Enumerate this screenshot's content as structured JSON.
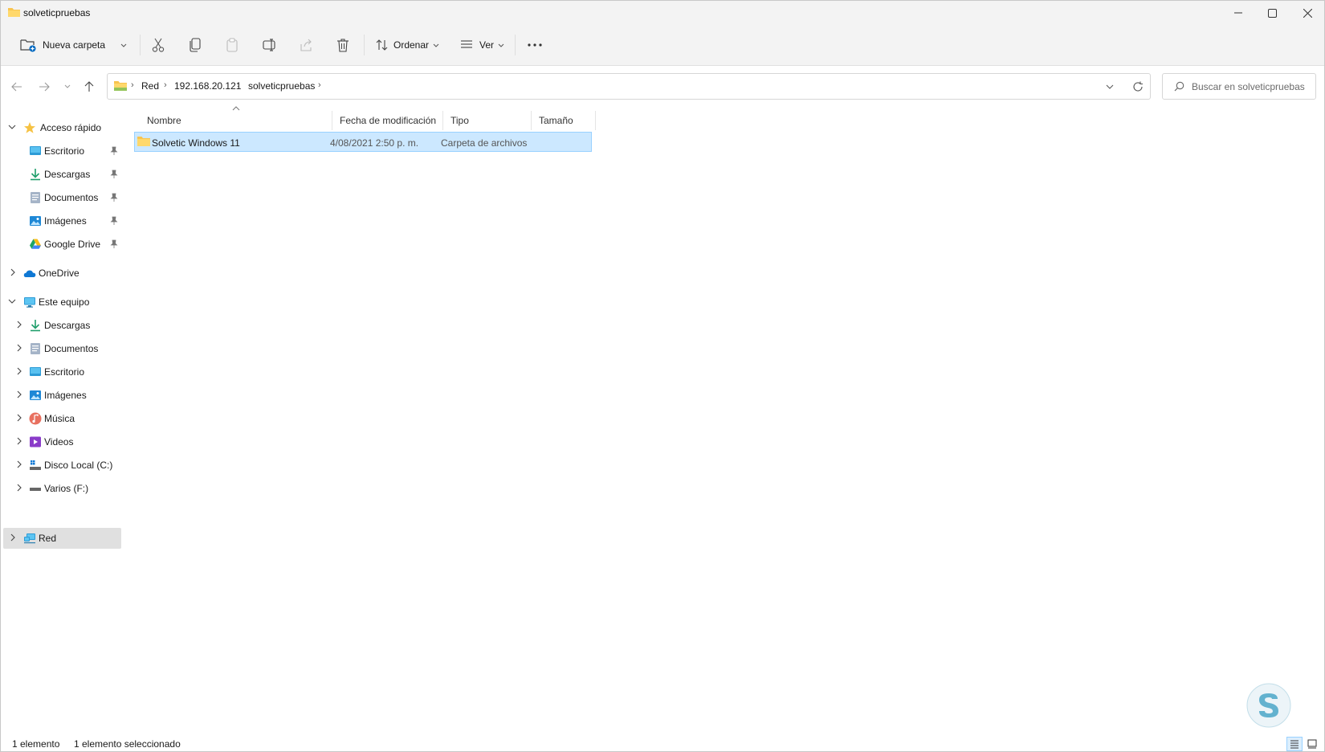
{
  "window": {
    "title": "solveticpruebas"
  },
  "toolbar": {
    "new_folder": "Nueva carpeta",
    "sort": "Ordenar",
    "view": "Ver"
  },
  "address": {
    "crumbs": [
      "Red",
      "192.168.20.121",
      "solveticpruebas"
    ],
    "search_placeholder": "Buscar en solveticpruebas"
  },
  "sidebar": {
    "quick_access": "Acceso rápido",
    "quick_items": [
      "Escritorio",
      "Descargas",
      "Documentos",
      "Imágenes",
      "Google Drive"
    ],
    "onedrive": "OneDrive",
    "this_pc": "Este equipo",
    "pc_items": [
      "Descargas",
      "Documentos",
      "Escritorio",
      "Imágenes",
      "Música",
      "Videos",
      "Disco Local (C:)",
      "Varios (F:)"
    ],
    "network": "Red"
  },
  "columns": {
    "name": "Nombre",
    "date": "Fecha de modificación",
    "type": "Tipo",
    "size": "Tamaño"
  },
  "files": [
    {
      "name": "Solvetic  Windows 11",
      "date": "4/08/2021 2:50 p. m.",
      "type": "Carpeta de archivos",
      "size": ""
    }
  ],
  "status": {
    "count": "1 elemento",
    "selected": "1 elemento seleccionado"
  },
  "colors": {
    "accent": "#0067c0",
    "selection_bg": "#cce8ff",
    "selection_border": "#99d1ff",
    "folder": "#f8c44f"
  }
}
